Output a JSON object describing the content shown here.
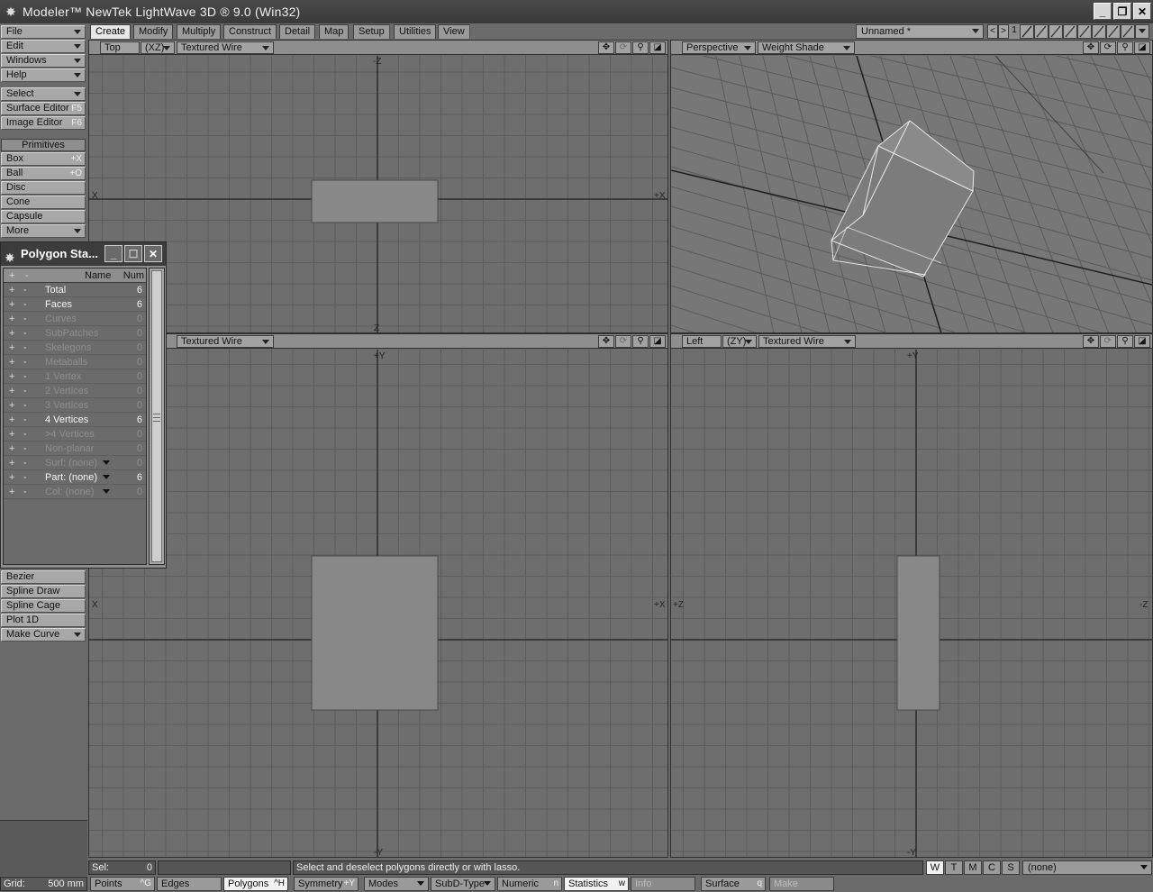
{
  "window": {
    "title": "Modeler™ NewTek LightWave 3D ® 9.0 (Win32)",
    "minimize": "_",
    "restore": "❐",
    "close": "✕"
  },
  "left_menu": {
    "file": "File",
    "edit": "Edit",
    "windows": "Windows",
    "help": "Help",
    "select": "Select",
    "surface_editor": "Surface Editor",
    "surface_editor_shortcut": "F5",
    "image_editor": "Image Editor",
    "image_editor_shortcut": "F6",
    "primitives_header": "Primitives",
    "box": "Box",
    "box_shortcut": "+X",
    "ball": "Ball",
    "ball_shortcut": "+O",
    "disc": "Disc",
    "cone": "Cone",
    "capsule": "Capsule",
    "more": "More",
    "bezier": "Bezier",
    "spline_draw": "Spline Draw",
    "spline_cage": "Spline Cage",
    "plot_1d": "Plot 1D",
    "make_curve": "Make Curve"
  },
  "tabs": [
    "Create",
    "Modify",
    "Multiply",
    "Construct",
    "Detail",
    "Map",
    "Setup",
    "Utilities",
    "View"
  ],
  "object_selector": "Unnamed *",
  "layer_nav": {
    "prev": "<",
    "next": ">",
    "layer": "1"
  },
  "viewports": {
    "top": {
      "view": "Top",
      "axes": "(XZ)",
      "mode": "Textured Wire"
    },
    "perspective": {
      "view": "Perspective",
      "mode": "Weight Shade"
    },
    "back": {
      "mode": "Textured Wire"
    },
    "left": {
      "view": "Left",
      "axes": "(ZY)",
      "mode": "Textured Wire"
    }
  },
  "axis_labels": {
    "top": {
      "top": "-Z",
      "bottom": "Z",
      "left": "X",
      "right": "+X"
    },
    "back": {
      "top": "+Y",
      "bottom": "-Y",
      "left": "X",
      "right": "+X"
    },
    "left": {
      "top": "+Y",
      "bottom": "-Y",
      "left": "+Z",
      "right": "-Z"
    }
  },
  "polygon_stats": {
    "title": "Polygon Sta...",
    "header": {
      "name": "Name",
      "num": "Num"
    },
    "rows": [
      {
        "plus": "+",
        "minus": "-",
        "name": "Total",
        "num": "6",
        "state": "bright"
      },
      {
        "plus": "+",
        "minus": "-",
        "name": "Faces",
        "num": "6",
        "state": "bright"
      },
      {
        "plus": "+",
        "minus": "-",
        "name": "Curves",
        "num": "0",
        "state": "dim"
      },
      {
        "plus": "+",
        "minus": "-",
        "name": "SubPatches",
        "num": "0",
        "state": "dim"
      },
      {
        "plus": "+",
        "minus": "-",
        "name": "Skelegons",
        "num": "0",
        "state": "dim"
      },
      {
        "plus": "+",
        "minus": "-",
        "name": "Metaballs",
        "num": "0",
        "state": "dim"
      },
      {
        "plus": "+",
        "minus": "-",
        "name": "1 Vertex",
        "num": "0",
        "state": "dim"
      },
      {
        "plus": "+",
        "minus": "-",
        "name": "2 Vertices",
        "num": "0",
        "state": "dim"
      },
      {
        "plus": "+",
        "minus": "-",
        "name": "3 Vertices",
        "num": "0",
        "state": "dim"
      },
      {
        "plus": "+",
        "minus": "-",
        "name": "4 Vertices",
        "num": "6",
        "state": "bright"
      },
      {
        "plus": "+",
        "minus": "-",
        "name": ">4 Vertices",
        "num": "0",
        "state": "dim"
      },
      {
        "plus": "+",
        "minus": "-",
        "name": "Non-planar",
        "num": "0",
        "state": "dim"
      },
      {
        "plus": "+",
        "minus": "-",
        "name": "Surf: (none)",
        "num": "0",
        "state": "dim",
        "dropdown": true
      },
      {
        "plus": "+",
        "minus": "-",
        "name": "Part: (none)",
        "num": "6",
        "state": "bright",
        "dropdown": true
      },
      {
        "plus": "+",
        "minus": "-",
        "name": "Col: (none)",
        "num": "0",
        "state": "dim",
        "dropdown": true
      }
    ]
  },
  "status": {
    "sel_label": "Sel:",
    "sel_value": "0",
    "message": "Select and deselect polygons directly or with lasso.",
    "wtmcs": [
      "W",
      "T",
      "M",
      "C",
      "S"
    ],
    "vmap": "(none)"
  },
  "bottom": {
    "grid_label": "Grid:",
    "grid_value": "500 mm",
    "points": "Points",
    "points_sc": "^G",
    "edges": "Edges",
    "polygons": "Polygons",
    "polygons_sc": "^H",
    "symmetry": "Symmetry",
    "symmetry_sc": "+Y",
    "modes": "Modes",
    "subd": "SubD-Type",
    "numeric": "Numeric",
    "numeric_sc": "n",
    "statistics": "Statistics",
    "statistics_sc": "w",
    "info": "Info",
    "surface": "Surface",
    "surface_sc": "q",
    "make": "Make"
  }
}
